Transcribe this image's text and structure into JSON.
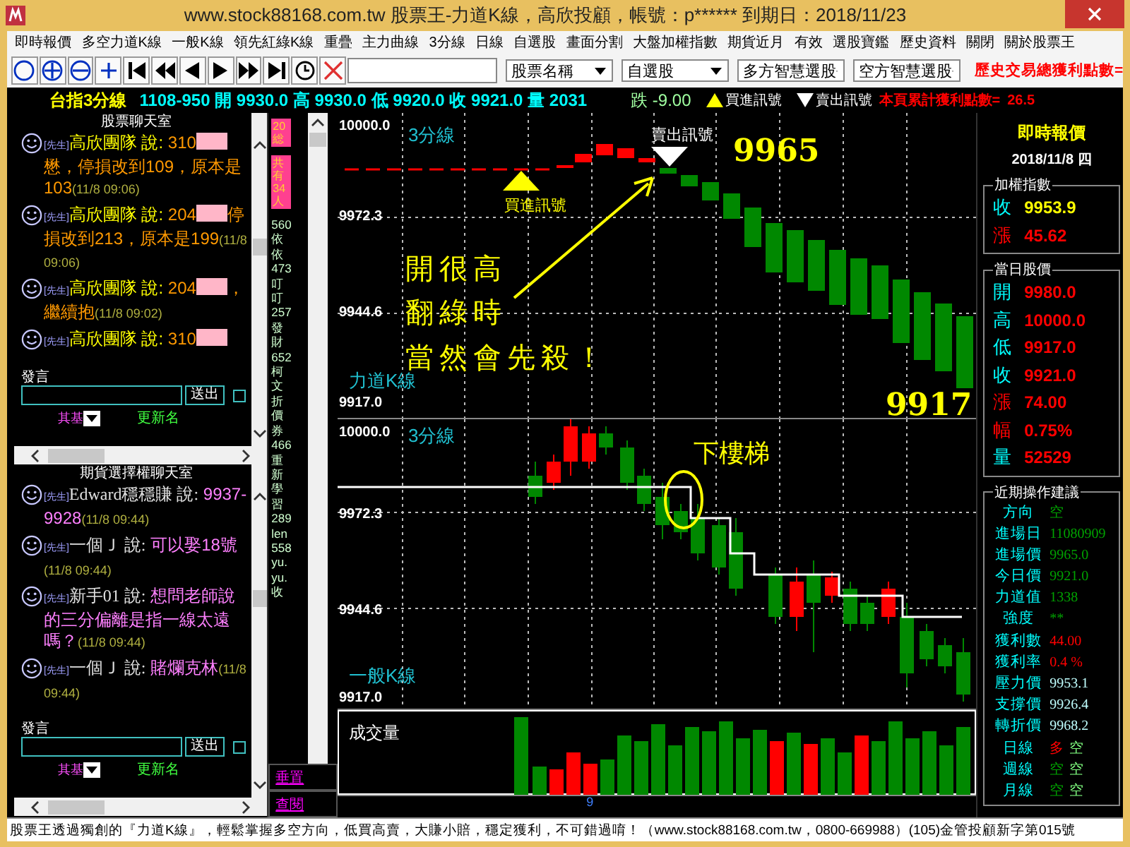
{
  "window": {
    "title": "www.stock88168.com.tw 股票王-力道K線，高欣投顧，帳號：p******  到期日：2018/11/23"
  },
  "menu": [
    "即時報價",
    "多空力道K線",
    "一般K線",
    "領先紅綠K線",
    "重疊",
    "主力曲線",
    "3分線",
    "日線",
    "自選股",
    "畫面分割",
    "大盤加權指數",
    "期貨近月",
    "有效",
    "選股寶鑑",
    "歷史資料",
    "關閉",
    "關於股票王"
  ],
  "toolbar": {
    "dropdowns": [
      "股票名稱",
      "自選股",
      "多方智慧選股",
      "空方智慧選股"
    ],
    "total_profit_label": "歷史交易總獲利點數="
  },
  "info_bar": {
    "title": "台指3分線",
    "quote": "1108-950 開 9930.0 高 9930.0 低 9920.0 收 9921.0 量 2031",
    "change": "跌 -9.00",
    "buy_legend": "買進訊號",
    "sell_legend": "賣出訊號",
    "page_profit_label": "本頁累計獲利點數=",
    "page_profit_value": "26.5"
  },
  "chat_rooms": [
    {
      "title": "股票聊天室",
      "messages": [
        {
          "tag": "[先生]",
          "name": "高欣團隊",
          "verb": "說:",
          "text": "310",
          "redacted": true,
          "text_after": "懋，停損改到109，原本是103",
          "time": "(11/8 09:06)"
        },
        {
          "tag": "[先生]",
          "name": "高欣團隊",
          "verb": "說:",
          "text": "204",
          "redacted": true,
          "text_after": "停損改到213，原本是199",
          "time": "(11/8 09:06)"
        },
        {
          "tag": "[先生]",
          "name": "高欣團隊",
          "verb": "說:",
          "text": "204",
          "redacted": true,
          "text_after": "，繼續抱",
          "time": "(11/8 09:02)"
        },
        {
          "tag": "[先生]",
          "name": "高欣團隊",
          "verb": "說:",
          "text": "310",
          "redacted": true
        }
      ],
      "input_label": "發言",
      "send_button": "送出",
      "checked": false,
      "update_label": "更新名",
      "select_value": "其基"
    },
    {
      "title": "期貨選擇權聊天室",
      "messages": [
        {
          "tag": "[先生]",
          "name": "Edward穩穩賺",
          "verb": "說:",
          "text": "9937-9928",
          "time": "(11/8 09:44)"
        },
        {
          "tag": "[先生]",
          "name": "一個Ｊ",
          "verb": "說:",
          "text": "可以娶18號",
          "time": "(11/8 09:44)"
        },
        {
          "tag": "[先生]",
          "name": "新手01",
          "verb": "說:",
          "text": "想問老師說的三分偏離是指一線太遠嗎？",
          "time": "(11/8 09:44)"
        },
        {
          "tag": "[先生]",
          "name": "一個Ｊ",
          "verb": "說:",
          "text": "賭爛克林",
          "time": "(11/8 09:44)"
        }
      ],
      "input_label": "發言",
      "send_button": "送出",
      "checked": false,
      "update_label": "更新名",
      "select_value": "其基"
    }
  ],
  "side_strip": {
    "badges": [
      "20総",
      "共有34人"
    ],
    "users": [
      "560",
      "依",
      "依",
      "473",
      "叮",
      "叮",
      "257",
      "發",
      "財",
      "652",
      "柯",
      "文",
      "折",
      "價",
      "券",
      "466",
      "重",
      "新",
      "學",
      "習",
      "289",
      "len",
      "558",
      "yu.",
      "yu.",
      "收"
    ],
    "buttons": [
      "垂置",
      "查閱"
    ]
  },
  "top_chart": {
    "period_label": "3分線",
    "type_label": "力道K線",
    "yticks": [
      "10000.0",
      "9972.3",
      "9944.6",
      "9917.0"
    ],
    "sell_signal": "賣出訊號",
    "buy_signal": "買進訊號",
    "sell_price": "9965",
    "last_price": "9917",
    "annotation": [
      "開很高",
      "翻綠時",
      "當然會先殺！"
    ]
  },
  "lower_chart": {
    "period_label": "3分線",
    "type_label": "一般K線",
    "yticks": [
      "10000.0",
      "9972.3",
      "9944.6",
      "9917.0"
    ],
    "annotation": "下樓梯"
  },
  "volume_chart": {
    "label": "成交量",
    "xlabel": "9"
  },
  "quote_panel": {
    "title": "即時報價",
    "date": "2018/11/8 四",
    "groups": [
      {
        "title": "加權指數",
        "rows": [
          {
            "label": "收",
            "color": "#00ffff",
            "values": [
              {
                "text": "9953.9",
                "color": "#ffff00"
              }
            ]
          },
          {
            "label": "漲",
            "color": "#ff0000",
            "values": [
              {
                "text": "45.62",
                "color": "#ff0000"
              }
            ]
          }
        ]
      },
      {
        "title": "當日股價",
        "rows": [
          {
            "label": "開",
            "color": "#00ffff",
            "values": [
              {
                "text": "9980.0",
                "color": "#ff0000"
              }
            ]
          },
          {
            "label": "高",
            "color": "#00ffff",
            "values": [
              {
                "text": "10000.0",
                "color": "#ff0000"
              }
            ]
          },
          {
            "label": "低",
            "color": "#00ffff",
            "values": [
              {
                "text": "9917.0",
                "color": "#ff0000"
              }
            ]
          },
          {
            "label": "收",
            "color": "#00ffff",
            "values": [
              {
                "text": "9921.0",
                "color": "#ff0000"
              }
            ]
          },
          {
            "label": "漲",
            "color": "#ff0000",
            "values": [
              {
                "text": "74.00",
                "color": "#ff0000"
              }
            ]
          },
          {
            "label": "幅",
            "color": "#ff0000",
            "values": [
              {
                "text": "0.75%",
                "color": "#ff0000"
              }
            ]
          },
          {
            "label": "量",
            "color": "#00ffff",
            "values": [
              {
                "text": "52529",
                "color": "#ff0000"
              }
            ]
          }
        ]
      },
      {
        "title": "近期操作建議",
        "small": true,
        "rows": [
          {
            "label": "方向",
            "color": "#00ffff",
            "values": [
              {
                "text": "空",
                "color": "#00a000"
              }
            ]
          },
          {
            "label": "進場日",
            "color": "#00ffff",
            "values": [
              {
                "text": "11080909",
                "color": "#00a000"
              }
            ]
          },
          {
            "label": "進場價",
            "color": "#00ffff",
            "values": [
              {
                "text": "9965.0",
                "color": "#00a000"
              }
            ]
          },
          {
            "label": "今日價",
            "color": "#00ffff",
            "values": [
              {
                "text": "9921.0",
                "color": "#00a000"
              }
            ]
          },
          {
            "label": "力道值",
            "color": "#00ffff",
            "values": [
              {
                "text": "1338",
                "color": "#00a000"
              }
            ]
          },
          {
            "label": "強度",
            "color": "#00ffff",
            "values": [
              {
                "text": "**",
                "color": "#00a000"
              }
            ]
          },
          {
            "label": "獲利數",
            "color": "#00ffff",
            "values": [
              {
                "text": "44.00",
                "color": "#ff0000"
              }
            ]
          },
          {
            "label": "獲利率",
            "color": "#00ffff",
            "values": [
              {
                "text": "0.4 %",
                "color": "#ff0000"
              }
            ]
          },
          {
            "label": "壓力價",
            "color": "#00ffff",
            "values": [
              {
                "text": "9953.1",
                "color": "#c0ffff"
              }
            ]
          },
          {
            "label": "支撐價",
            "color": "#00ffff",
            "values": [
              {
                "text": "9926.4",
                "color": "#c0ffff"
              }
            ]
          },
          {
            "label": "轉折價",
            "color": "#00ffff",
            "values": [
              {
                "text": "9968.2",
                "color": "#c0ffff"
              }
            ]
          },
          {
            "label": "日線",
            "color": "#00ffff",
            "values": [
              {
                "text": "多",
                "color": "#ff0000"
              },
              {
                "text": "空",
                "color": "#80ff80"
              }
            ]
          },
          {
            "label": "週線",
            "color": "#00ffff",
            "values": [
              {
                "text": "空",
                "color": "#00a000"
              },
              {
                "text": "空",
                "color": "#80ff80"
              }
            ]
          },
          {
            "label": "月線",
            "color": "#00ffff",
            "values": [
              {
                "text": "空",
                "color": "#00a000"
              },
              {
                "text": "空",
                "color": "#80ff80"
              }
            ]
          }
        ]
      }
    ]
  },
  "status_bar": "股票王透過獨創的『力道K線』，輕鬆掌握多空方向，低買高賣，大賺小賠，穩定獲利，不可錯過唷！（www.stock88168.com.tw，0800-669988）(105)金管投顧新字第015號"
}
